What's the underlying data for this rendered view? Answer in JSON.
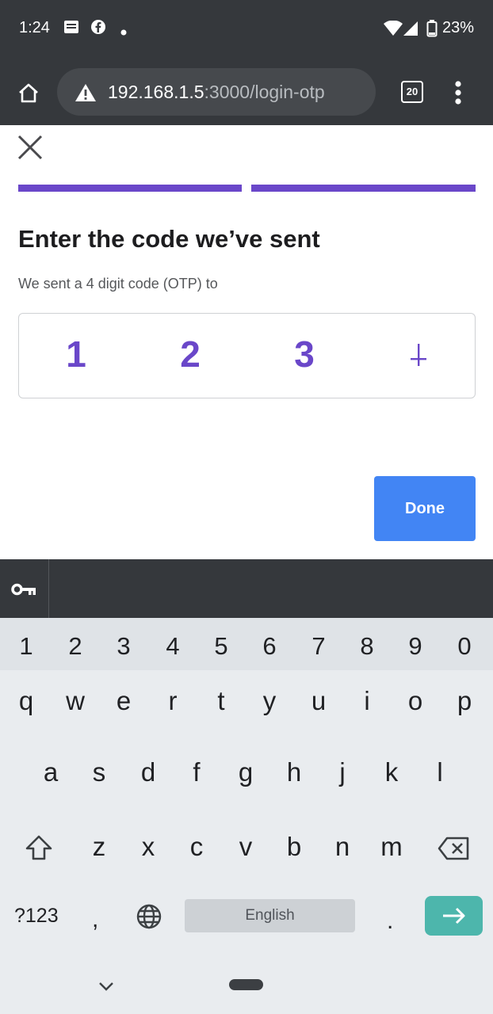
{
  "status_bar": {
    "time": "1:24",
    "battery": "23%",
    "icons": [
      "newspaper-icon",
      "facebook-icon",
      "dot-icon",
      "wifi-icon",
      "signal-icon",
      "battery-icon"
    ]
  },
  "browser": {
    "url_host": "192.168.1.5",
    "url_rest": ":3000/login-otp",
    "tab_count": "20",
    "icons": [
      "home-icon",
      "warning-icon",
      "tabs-icon",
      "more-vert-icon"
    ]
  },
  "page": {
    "progress_steps": 2,
    "title": "Enter the code we’ve sent",
    "subtitle": "We sent a 4 digit code (OTP) to",
    "otp_digits": [
      "1",
      "2",
      "3",
      ""
    ],
    "done_label": "Done",
    "accent_color": "#6a47c9",
    "button_color": "#4285f4"
  },
  "keyboard": {
    "number_row": [
      "1",
      "2",
      "3",
      "4",
      "5",
      "6",
      "7",
      "8",
      "9",
      "0"
    ],
    "row1": [
      "q",
      "w",
      "e",
      "r",
      "t",
      "y",
      "u",
      "i",
      "o",
      "p"
    ],
    "row2": [
      "a",
      "s",
      "d",
      "f",
      "g",
      "h",
      "j",
      "k",
      "l"
    ],
    "row3": [
      "z",
      "x",
      "c",
      "v",
      "b",
      "n",
      "m"
    ],
    "symbols_label": "?123",
    "comma": ",",
    "period": ".",
    "space_label": "English",
    "icons": [
      "key-icon",
      "shift-icon",
      "backspace-icon",
      "globe-icon",
      "enter-arrow-icon",
      "chevron-down-icon"
    ]
  }
}
